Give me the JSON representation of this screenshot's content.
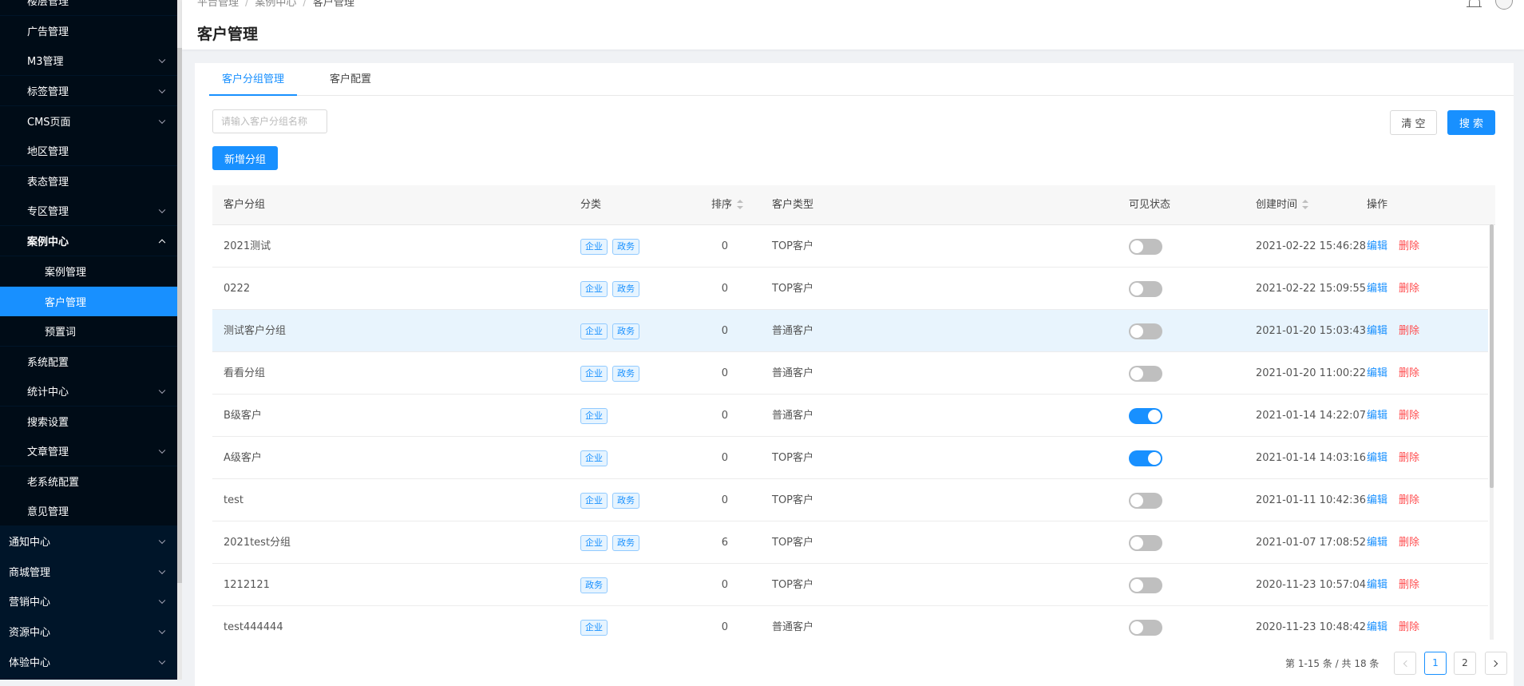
{
  "sidebar": {
    "items": [
      {
        "label": "楼层管理",
        "expandable": false
      },
      {
        "label": "广告管理",
        "expandable": false
      },
      {
        "label": "M3管理",
        "expandable": true
      },
      {
        "label": "标签管理",
        "expandable": true
      },
      {
        "label": "CMS页面",
        "expandable": true
      },
      {
        "label": "地区管理",
        "expandable": false
      },
      {
        "label": "表态管理",
        "expandable": false
      },
      {
        "label": "专区管理",
        "expandable": true
      },
      {
        "label": "案例中心",
        "expandable": true,
        "expanded": true
      },
      {
        "label": "案例管理",
        "expandable": false
      },
      {
        "label": "客户管理",
        "expandable": false,
        "active": true
      },
      {
        "label": "预置词",
        "expandable": false
      },
      {
        "label": "系统配置",
        "expandable": false
      },
      {
        "label": "统计中心",
        "expandable": true
      },
      {
        "label": "搜索设置",
        "expandable": false
      },
      {
        "label": "文章管理",
        "expandable": true
      },
      {
        "label": "老系统配置",
        "expandable": false
      },
      {
        "label": "意见管理",
        "expandable": false
      },
      {
        "label": "通知中心",
        "expandable": true
      },
      {
        "label": "商城管理",
        "expandable": true
      },
      {
        "label": "营销中心",
        "expandable": true
      },
      {
        "label": "资源中心",
        "expandable": true
      },
      {
        "label": "体验中心",
        "expandable": true
      }
    ]
  },
  "header": {
    "breadcrumb": [
      "平台管理",
      "案例中心",
      "客户管理"
    ],
    "title": "客户管理",
    "icons": [
      "bell-icon",
      "avatar-icon"
    ]
  },
  "tabs": [
    {
      "label": "客户分组管理",
      "active": true
    },
    {
      "label": "客户配置",
      "active": false
    }
  ],
  "filters": {
    "search_placeholder": "请输入客户分组名称",
    "search_value": "",
    "clear_label": "清 空",
    "search_label": "搜 索",
    "add_group_label": "新增分组"
  },
  "table": {
    "columns": {
      "group": "客户分组",
      "category": "分类",
      "sort": "排序",
      "type": "客户类型",
      "visible": "可见状态",
      "created": "创建时间",
      "actions": "操作"
    },
    "edit_label": "编辑",
    "delete_label": "删除",
    "rows": [
      {
        "group": "2021测试",
        "tags": [
          "企业",
          "政务"
        ],
        "sort": "0",
        "type": "TOP客户",
        "visible": false,
        "created": "2021-02-22 15:46:28"
      },
      {
        "group": "0222",
        "tags": [
          "企业",
          "政务"
        ],
        "sort": "0",
        "type": "TOP客户",
        "visible": false,
        "created": "2021-02-22 15:09:55"
      },
      {
        "group": "测试客户分组",
        "tags": [
          "企业",
          "政务"
        ],
        "sort": "0",
        "type": "普通客户",
        "visible": false,
        "created": "2021-01-20 15:03:43",
        "highlight": true
      },
      {
        "group": "看看分组",
        "tags": [
          "企业",
          "政务"
        ],
        "sort": "0",
        "type": "普通客户",
        "visible": false,
        "created": "2021-01-20 11:00:22"
      },
      {
        "group": "B级客户",
        "tags": [
          "企业"
        ],
        "sort": "0",
        "type": "普通客户",
        "visible": true,
        "created": "2021-01-14 14:22:07"
      },
      {
        "group": "A级客户",
        "tags": [
          "企业"
        ],
        "sort": "0",
        "type": "TOP客户",
        "visible": true,
        "created": "2021-01-14 14:03:16"
      },
      {
        "group": "test",
        "tags": [
          "企业",
          "政务"
        ],
        "sort": "0",
        "type": "TOP客户",
        "visible": false,
        "created": "2021-01-11 10:42:36"
      },
      {
        "group": "2021test分组",
        "tags": [
          "企业",
          "政务"
        ],
        "sort": "6",
        "type": "TOP客户",
        "visible": false,
        "created": "2021-01-07 17:08:52"
      },
      {
        "group": "1212121",
        "tags": [
          "政务"
        ],
        "sort": "0",
        "type": "TOP客户",
        "visible": false,
        "created": "2020-11-23 10:57:04"
      },
      {
        "group": "test444444",
        "tags": [
          "企业"
        ],
        "sort": "0",
        "type": "普通客户",
        "visible": false,
        "created": "2020-11-23 10:48:42"
      }
    ]
  },
  "pagination": {
    "total_text": "第 1-15 条 / 共 18 条",
    "pages": [
      "1",
      "2"
    ],
    "current": "1"
  },
  "colors": {
    "primary": "#1890ff",
    "danger": "#ff4d4f",
    "sidebar_bg": "#001529",
    "highlight_row": "#e8f4fd"
  }
}
